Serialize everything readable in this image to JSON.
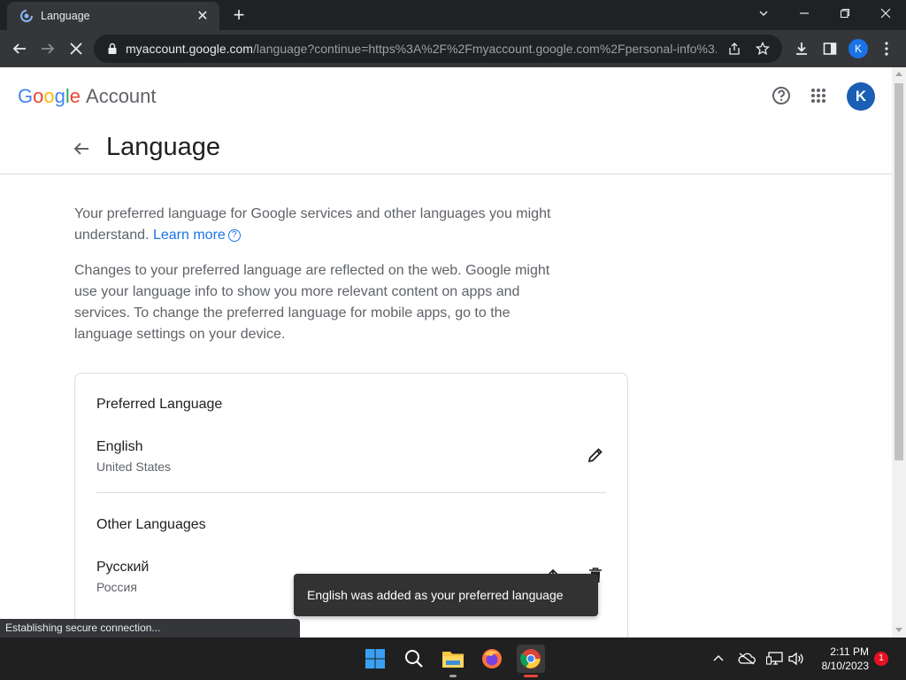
{
  "browser": {
    "tab_title": "Language",
    "url_host": "myaccount.google.com",
    "url_rest": "/language?continue=https%3A%2F%2Fmyaccount.google.com%2Fpersonal-info%3...",
    "profile_initial": "K",
    "status_text": "Establishing secure connection..."
  },
  "header": {
    "logo_letters": [
      "G",
      "o",
      "o",
      "g",
      "l",
      "e"
    ],
    "logo_colors": [
      "#4285F4",
      "#EA4335",
      "#FBBC05",
      "#4285F4",
      "#34A853",
      "#EA4335"
    ],
    "account_label": "Account",
    "avatar_initial": "K"
  },
  "page": {
    "title": "Language",
    "intro_text": "Your preferred language for Google services and other languages you might understand.",
    "learn_more": "Learn more",
    "help_glyph": "?",
    "description": "Changes to your preferred language are reflected on the web. Google might use your language info to show you more relevant content on apps and services. To change the preferred language for mobile apps, go to the language settings on your device."
  },
  "card": {
    "preferred_title": "Preferred Language",
    "preferred": {
      "name": "English",
      "region": "United States"
    },
    "other_title": "Other Languages",
    "other": [
      {
        "name": "Русский",
        "region": "Россия"
      }
    ]
  },
  "toast": {
    "message": "English was added as your preferred language"
  },
  "taskbar": {
    "time": "2:11 PM",
    "date": "8/10/2023",
    "notification_count": "1"
  },
  "colors": {
    "accent": "#1a73e8",
    "chrome_dark": "#35363a",
    "toast_bg": "#323232"
  }
}
